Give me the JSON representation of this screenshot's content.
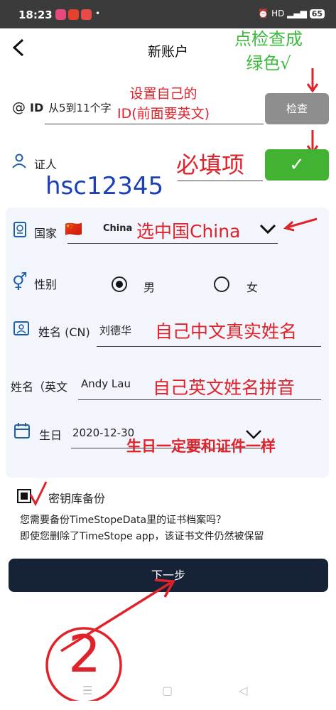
{
  "status_bar": {
    "time": "18:23",
    "right": "HD",
    "battery": "65",
    "app_colors": [
      "#e64a7a",
      "#e5422d",
      "#e84a4a"
    ]
  },
  "header": {
    "title": "新账户",
    "back_icon": "chevron-left-icon"
  },
  "form": {
    "id_label": "ID",
    "id_placeholder": "从5到11个字",
    "check_button": "检查",
    "cert_label": "证人",
    "cert_value": "hsc12345",
    "confirm_button": "✓",
    "country_label": "国家",
    "country_flag": "🇨🇳",
    "country_value": "China",
    "gender_label": "性别",
    "gender_male": "男",
    "gender_female": "女",
    "name_cn_label": "姓名 (CN)",
    "name_cn_value": "刘德华",
    "name_en_label": "姓名（英文",
    "name_en_value": "Andy Lau",
    "birthday_label": "生日",
    "birthday_value": "2020-12-30"
  },
  "backup": {
    "label": "密钥库备份",
    "question": "您需要备份TimeStopeData里的证书档案吗？",
    "description": "即使您删除了TimeStope app，该证书文件仍然被保留"
  },
  "next_button": "下一步",
  "annotations": {
    "check_green": "点检查成\n绿色√",
    "set_id": "设置自己的\nID(前面要英文)",
    "required": "必填项",
    "choose_china": "选中国China",
    "cn_name": "自己中文真实姓名",
    "en_name": "自己英文姓名拼音",
    "birthday_same": "生日一定要和证件一样",
    "step_number": "2"
  },
  "colors": {
    "annotation_red": "#e0222b",
    "annotation_green": "#3dbb3d",
    "check_button": "#8e8e8e",
    "confirm_button": "#42b232",
    "next_button": "#162235",
    "form_bg": "#f2f6fc"
  }
}
